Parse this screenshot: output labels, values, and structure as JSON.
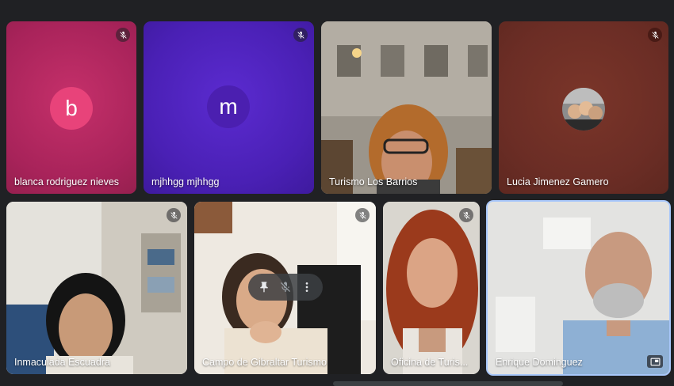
{
  "participants": [
    {
      "name": "blanca rodriguez nieves",
      "initial": "b",
      "muted": true,
      "tile_color": "#b8285f",
      "avatar_color": "#e8437a"
    },
    {
      "name": "mjhhgg mjhhgg",
      "initial": "m",
      "muted": true,
      "tile_color": "#4a20b5",
      "avatar_color": "#4b1fb0"
    },
    {
      "name": "Turismo Los Barrios",
      "muted": false
    },
    {
      "name": "Lucia Jimenez Gamero",
      "muted": true,
      "tile_color": "#6b2d25"
    },
    {
      "name": "Inmaculada Escuadra",
      "muted": true
    },
    {
      "name": "Campo de Gibraltar Turismo",
      "muted": true
    },
    {
      "name": "Oficina de Turis...",
      "muted": true
    },
    {
      "name": "Enrique Dominguez",
      "muted": false
    }
  ],
  "icons": {
    "mute": "mic-off-icon",
    "pin": "pin-icon",
    "more": "more-vert-icon",
    "pip": "picture-in-picture-icon"
  },
  "colors": {
    "background": "#202124",
    "active_speaker_border": "#a8c7fa"
  }
}
